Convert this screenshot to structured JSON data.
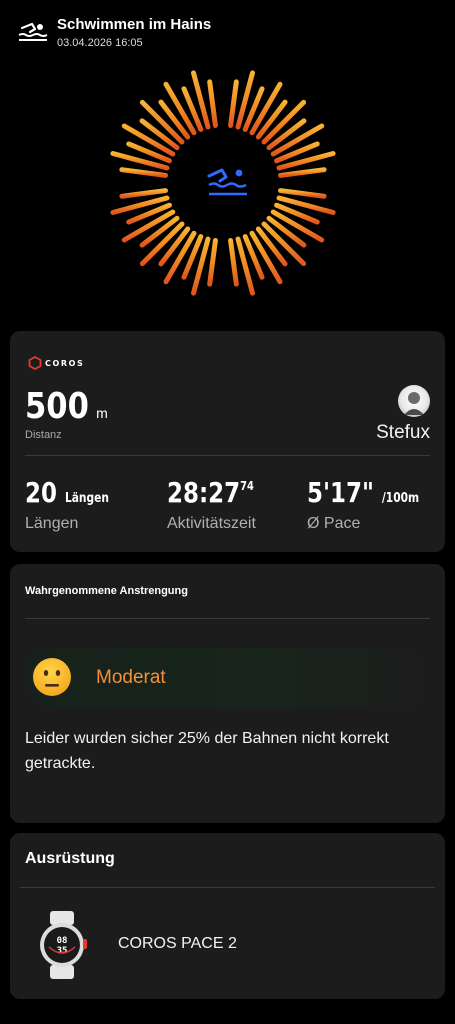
{
  "header": {
    "title": "Schwimmen im Hains",
    "datetime": "03.04.2026 16:05",
    "icon": "swimmer-icon"
  },
  "summary": {
    "brand": "COROS",
    "distance_value": "500",
    "distance_unit": "m",
    "distance_label": "Distanz",
    "user_name": "Stefux",
    "stats": [
      {
        "value": "20",
        "unit": "Längen",
        "label": "Längen"
      },
      {
        "value": "28:27",
        "fraction": "74",
        "label": "Aktivitätszeit"
      },
      {
        "value": "5'17\"",
        "unit": "/100m",
        "label": "Ø Pace"
      }
    ]
  },
  "effort": {
    "title": "Wahrgenommene Anstrengung",
    "level": "Moderat",
    "emoji": "neutral-face-icon",
    "message": "Leider wurden sicher 25% der Bahnen nicht korrekt getrackte."
  },
  "equipment": {
    "title": "Ausrüstung",
    "device_name": "COROS PACE 2",
    "device_icon": "smartwatch-icon"
  },
  "colors": {
    "background": "#000000",
    "card": "#1c1c1c",
    "accent_orange": "#f2913a",
    "swim_blue": "#2f6bff",
    "brand_red": "#e53935"
  }
}
